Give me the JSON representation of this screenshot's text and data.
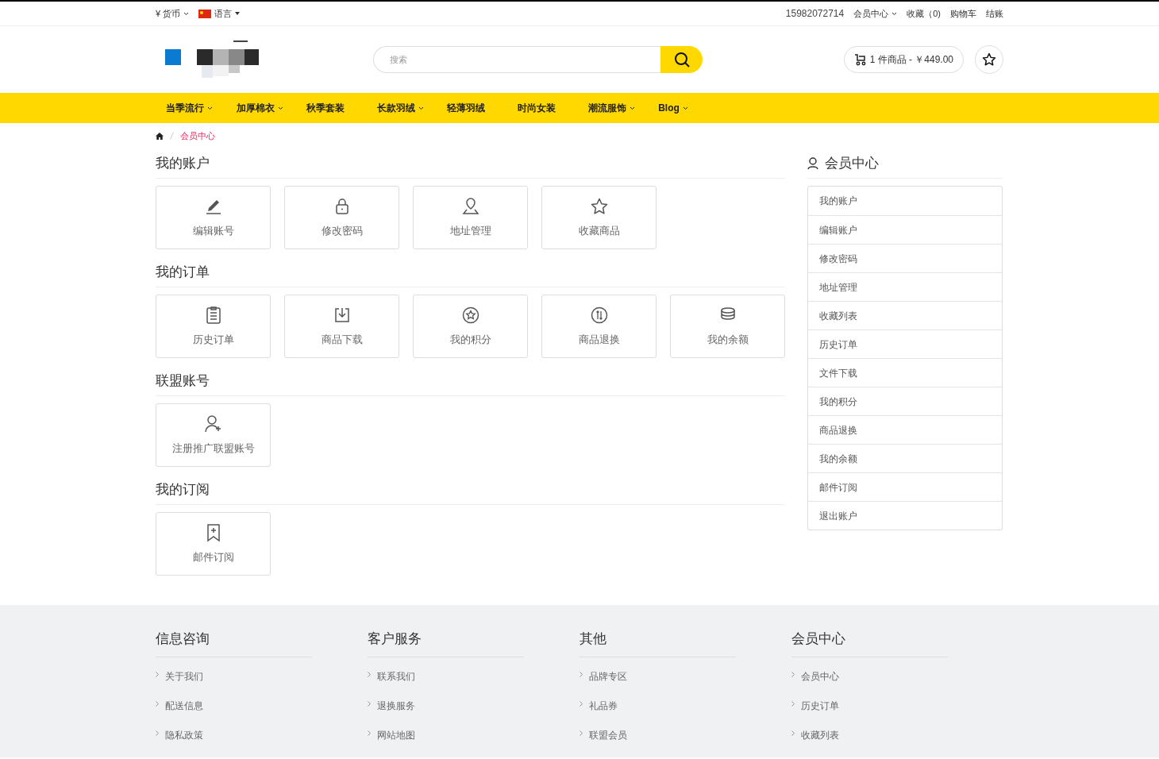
{
  "top_bar": {
    "currency": {
      "symbol": "¥",
      "label": "货币"
    },
    "language": {
      "label": "语言"
    },
    "phone": "15982072714",
    "links": [
      {
        "label": "会员中心",
        "dropdown": true
      },
      {
        "label": "收藏（0)",
        "dropdown": false
      },
      {
        "label": "购物车",
        "dropdown": false
      },
      {
        "label": "结账",
        "dropdown": false
      }
    ]
  },
  "header": {
    "search": {
      "placeholder": "搜索"
    },
    "cart": {
      "label": "1 件商品 - ￥449.00"
    }
  },
  "nav": [
    {
      "label": "当季流行",
      "dropdown": true
    },
    {
      "label": "加厚棉衣",
      "dropdown": true
    },
    {
      "label": "秋季套装",
      "dropdown": false
    },
    {
      "label": "长款羽绒",
      "dropdown": true
    },
    {
      "label": "轻薄羽绒",
      "dropdown": false
    },
    {
      "label": "时尚女装",
      "dropdown": false
    },
    {
      "label": "潮流服饰",
      "dropdown": true
    },
    {
      "label": "Blog",
      "dropdown": true
    }
  ],
  "breadcrumb": [
    {
      "label": "会员中心"
    }
  ],
  "sections": [
    {
      "title": "我的账户",
      "cards": [
        {
          "kind": "pencil",
          "label": "编辑账号"
        },
        {
          "kind": "lock",
          "label": "修改密码"
        },
        {
          "kind": "pin",
          "label": "地址管理"
        },
        {
          "kind": "star",
          "label": "收藏商品"
        }
      ]
    },
    {
      "title": "我的订单",
      "cards": [
        {
          "kind": "clipboard",
          "label": "历史订单"
        },
        {
          "kind": "download",
          "label": "商品下载"
        },
        {
          "kind": "points",
          "label": "我的积分"
        },
        {
          "kind": "exchange",
          "label": "商品退换"
        },
        {
          "kind": "coins",
          "label": "我的余额"
        }
      ]
    },
    {
      "title": "联盟账号",
      "cards": [
        {
          "kind": "userplus",
          "label": "注册推广联盟账号"
        }
      ]
    },
    {
      "title": "我的订阅",
      "cards": [
        {
          "kind": "bookmark",
          "label": "邮件订阅"
        }
      ]
    }
  ],
  "sidebar": {
    "title": "会员中心",
    "items": [
      "我的账户",
      "编辑账户",
      "修改密码",
      "地址管理",
      "收藏列表",
      "历史订单",
      "文件下载",
      "我的积分",
      "商品退换",
      "我的余额",
      "邮件订阅",
      "退出账户"
    ]
  },
  "footer": [
    {
      "title": "信息咨询",
      "links": [
        "关于我们",
        "配送信息",
        "隐私政策"
      ]
    },
    {
      "title": "客户服务",
      "links": [
        "联系我们",
        "退换服务",
        "网站地图"
      ]
    },
    {
      "title": "其他",
      "links": [
        "品牌专区",
        "礼品券",
        "联盟会员"
      ]
    },
    {
      "title": "会员中心",
      "links": [
        "会员中心",
        "历史订单",
        "收藏列表"
      ]
    }
  ]
}
